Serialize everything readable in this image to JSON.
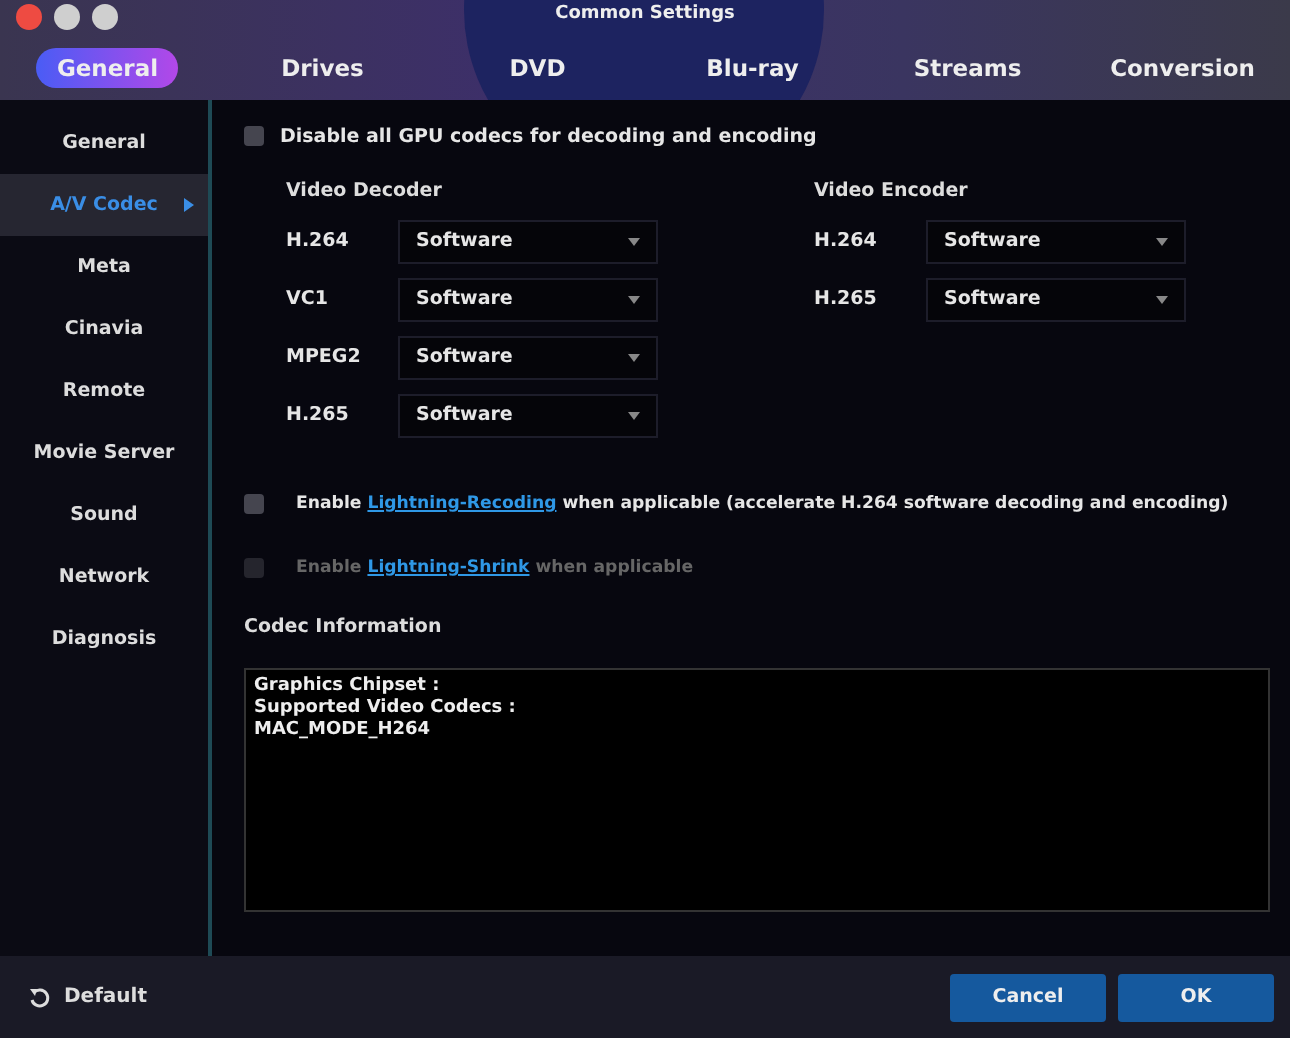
{
  "window": {
    "title": "Common Settings"
  },
  "tabs": [
    {
      "label": "General",
      "selected": true
    },
    {
      "label": "Drives",
      "selected": false
    },
    {
      "label": "DVD",
      "selected": false
    },
    {
      "label": "Blu-ray",
      "selected": false
    },
    {
      "label": "Streams",
      "selected": false
    },
    {
      "label": "Conversion",
      "selected": false
    }
  ],
  "sidebar": {
    "items": [
      {
        "label": "General",
        "selected": false
      },
      {
        "label": "A/V Codec",
        "selected": true
      },
      {
        "label": "Meta",
        "selected": false
      },
      {
        "label": "Cinavia",
        "selected": false
      },
      {
        "label": "Remote",
        "selected": false
      },
      {
        "label": "Movie Server",
        "selected": false
      },
      {
        "label": "Sound",
        "selected": false
      },
      {
        "label": "Network",
        "selected": false
      },
      {
        "label": "Diagnosis",
        "selected": false
      }
    ]
  },
  "disable_gpu": {
    "label": "Disable all GPU codecs for decoding and encoding",
    "checked": false
  },
  "video_decoder": {
    "title": "Video Decoder",
    "rows": [
      {
        "codec": "H.264",
        "value": "Software"
      },
      {
        "codec": "VC1",
        "value": "Software"
      },
      {
        "codec": "MPEG2",
        "value": "Software"
      },
      {
        "codec": "H.265",
        "value": "Software"
      }
    ]
  },
  "video_encoder": {
    "title": "Video Encoder",
    "rows": [
      {
        "codec": "H.264",
        "value": "Software"
      },
      {
        "codec": "H.265",
        "value": "Software"
      }
    ]
  },
  "options": [
    {
      "before": "Enable",
      "link": "Lightning-Recoding",
      "after": "when applicable (accelerate H.264 software decoding and encoding)",
      "checked": false,
      "disabled": false
    },
    {
      "before": "Enable",
      "link": "Lightning-Shrink",
      "after": "when applicable",
      "checked": false,
      "disabled": true
    }
  ],
  "codec_information": {
    "title": "Codec Information",
    "lines": [
      "Graphics Chipset :",
      "Supported Video Codecs :",
      "MAC_MODE_H264"
    ]
  },
  "footer": {
    "default_label": "Default",
    "buttons": [
      "Cancel",
      "OK"
    ]
  }
}
